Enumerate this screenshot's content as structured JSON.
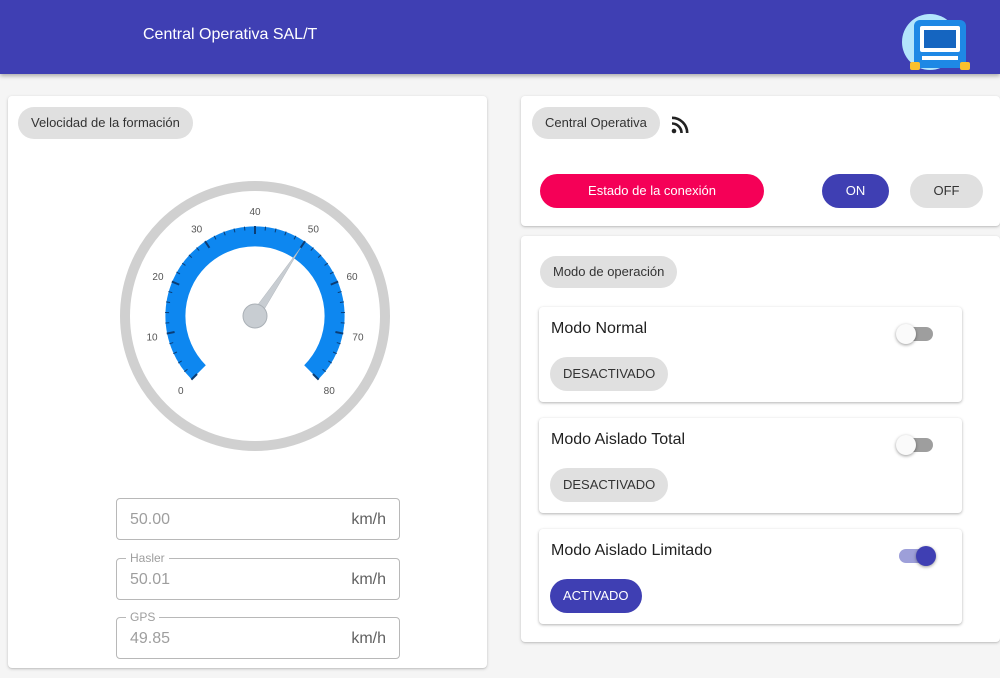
{
  "app": {
    "title": "Central Operativa SAL/T",
    "logo_icon": "train-icon"
  },
  "speed_card": {
    "chip_label": "Velocidad de la formación",
    "gauge": {
      "min": 0,
      "max": 80,
      "value": 50,
      "tick_labels": [
        "0",
        "10",
        "20",
        "30",
        "40",
        "50",
        "60",
        "70",
        "80"
      ],
      "arc_color": "#0d87f0",
      "ring_color": "#d0d0d0",
      "needle_color": "#c8cdd2"
    },
    "fields": [
      {
        "legend": "",
        "value": "50.00",
        "unit": "km/h"
      },
      {
        "legend": "Hasler",
        "value": "50.01",
        "unit": "km/h"
      },
      {
        "legend": "GPS",
        "value": "49.85",
        "unit": "km/h"
      }
    ]
  },
  "central_card": {
    "chip_label": "Central Operativa",
    "signal_icon": "rss-feed-icon",
    "connection_button": "Estado de la conexión",
    "on_button": "ON",
    "off_button": "OFF"
  },
  "mode_card": {
    "chip_label": "Modo de operación",
    "modes": [
      {
        "title": "Modo Normal",
        "status": "DESACTIVADO",
        "enabled": false
      },
      {
        "title": "Modo Aislado Total",
        "status": "DESACTIVADO",
        "enabled": false
      },
      {
        "title": "Modo Aislado Limitado",
        "status": "ACTIVADO",
        "enabled": true
      }
    ]
  },
  "colors": {
    "primary": "#3f3fb3",
    "accent": "#f50057",
    "gauge_blue": "#0d87f0",
    "background": "#f5f5f5"
  }
}
